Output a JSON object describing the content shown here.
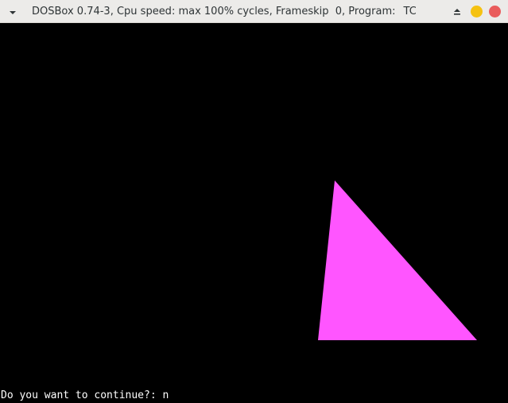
{
  "window": {
    "title": "DOSBox 0.74-3, Cpu speed: max 100% cycles, Frameskip  0, Program:",
    "program": "TC",
    "controls": {
      "menu_icon": "chevron-down-icon",
      "shade_icon": "eject-icon",
      "minimize_icon": "minimize-icon",
      "close_icon": "close-icon",
      "minimize_color": "#f5c211",
      "close_color": "#e95c5c"
    }
  },
  "screen": {
    "background": "#000000",
    "shape": {
      "type": "triangle",
      "fill": "#ff55ff"
    },
    "prompt": {
      "question": "Do you want to continue?: ",
      "answer": "n"
    }
  }
}
